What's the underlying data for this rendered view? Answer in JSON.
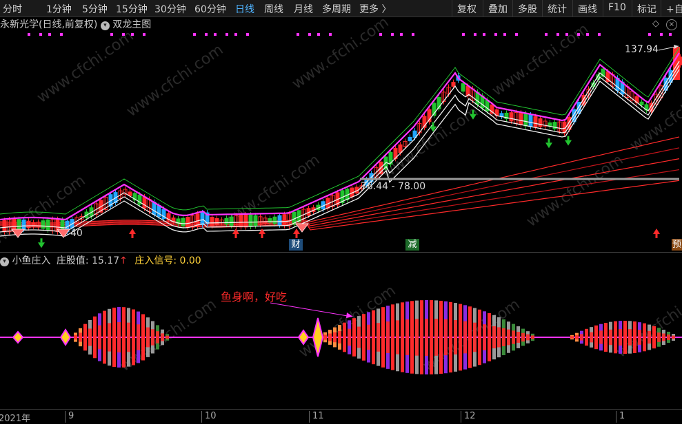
{
  "toolbar": {
    "periods": [
      "分时",
      "1分钟",
      "5分钟",
      "15分钟",
      "30分钟",
      "60分钟",
      "日线",
      "周线",
      "月线",
      "多周期",
      "更多 〉"
    ],
    "active_period": "日线",
    "right_buttons": [
      "复权",
      "叠加",
      "多股",
      "统计",
      "画线",
      "F10",
      "标记",
      "+自"
    ]
  },
  "title": {
    "stock_name": "永新光学(日线,前复权)",
    "formula": "双龙主图"
  },
  "main_chart": {
    "high_label": "137.94",
    "range_label": "76.44 - 78.00",
    "low_label": "40",
    "event_labels": [
      "财",
      "减",
      "预"
    ]
  },
  "indicator": {
    "name": "小鱼庄入",
    "value_label": "庄股值:",
    "value": "15.17",
    "signal_label": "庄入信号:",
    "signal_value": "0.00",
    "annotation": "鱼身啊，好吃"
  },
  "date_axis": [
    "2021年",
    "9",
    "10",
    "11",
    "12",
    "1"
  ],
  "watermark": "www.cfchi.com",
  "colors": {
    "up": "#ff2a2a",
    "down": "#22c430",
    "magenta": "#ff33ff",
    "purple": "#8a2be2",
    "gray": "#9a9a9a",
    "orange": "#ff8c40",
    "active_tab": "#4fb3ff"
  }
}
